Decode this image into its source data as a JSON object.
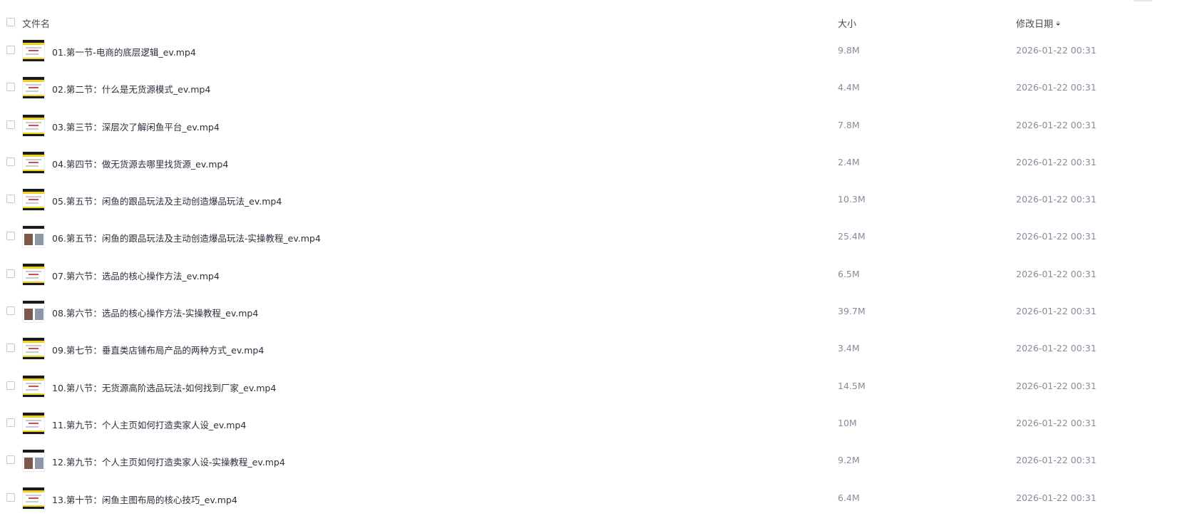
{
  "header": {
    "name_label": "文件名",
    "size_label": "大小",
    "date_label": "修改日期"
  },
  "files": [
    {
      "name": "01.第一节-电商的底层逻辑_ev.mp4",
      "size": "9.8M",
      "date": "2026-01-22 00:31",
      "thumb": "slide"
    },
    {
      "name": "02.第二节：什么是无货源模式_ev.mp4",
      "size": "4.4M",
      "date": "2026-01-22 00:31",
      "thumb": "slide"
    },
    {
      "name": "03.第三节：深层次了解闲鱼平台_ev.mp4",
      "size": "7.8M",
      "date": "2026-01-22 00:31",
      "thumb": "slide"
    },
    {
      "name": "04.第四节：做无货源去哪里找货源_ev.mp4",
      "size": "2.4M",
      "date": "2026-01-22 00:31",
      "thumb": "slide"
    },
    {
      "name": "05.第五节：闲鱼的跟品玩法及主动创造爆品玩法_ev.mp4",
      "size": "10.3M",
      "date": "2026-01-22 00:31",
      "thumb": "slide"
    },
    {
      "name": "06.第五节：闲鱼的跟品玩法及主动创造爆品玩法-实操教程_ev.mp4",
      "size": "25.4M",
      "date": "2026-01-22 00:31",
      "thumb": "photo"
    },
    {
      "name": "07.第六节：选品的核心操作方法_ev.mp4",
      "size": "6.5M",
      "date": "2026-01-22 00:31",
      "thumb": "slide"
    },
    {
      "name": "08.第六节：选品的核心操作方法-实操教程_ev.mp4",
      "size": "39.7M",
      "date": "2026-01-22 00:31",
      "thumb": "photo"
    },
    {
      "name": "09.第七节：垂直类店铺布局产品的两种方式_ev.mp4",
      "size": "3.4M",
      "date": "2026-01-22 00:31",
      "thumb": "slide"
    },
    {
      "name": "10.第八节：无货源高阶选品玩法-如何找到厂家_ev.mp4",
      "size": "14.5M",
      "date": "2026-01-22 00:31",
      "thumb": "slide"
    },
    {
      "name": "11.第九节：个人主页如何打造卖家人设_ev.mp4",
      "size": "10M",
      "date": "2026-01-22 00:31",
      "thumb": "slide"
    },
    {
      "name": "12.第九节：个人主页如何打造卖家人设-实操教程_ev.mp4",
      "size": "9.2M",
      "date": "2026-01-22 00:31",
      "thumb": "photo"
    },
    {
      "name": "13.第十节：闲鱼主图布局的核心技巧_ev.mp4",
      "size": "6.4M",
      "date": "2026-01-22 00:31",
      "thumb": "slide"
    }
  ]
}
